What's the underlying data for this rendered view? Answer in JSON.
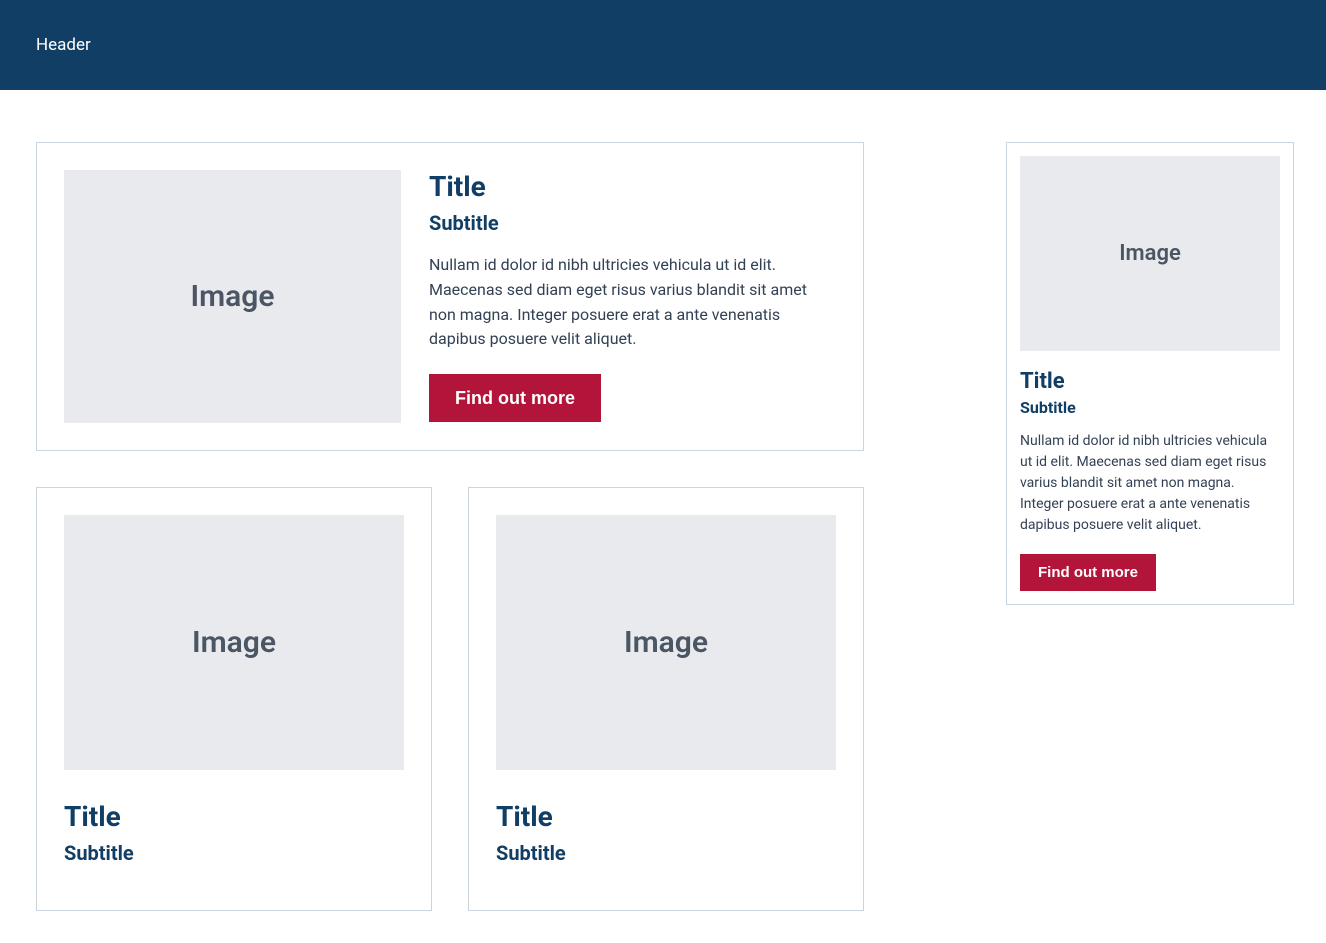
{
  "header": {
    "title": "Header"
  },
  "imagePlaceholder": "Image",
  "cards": {
    "hero": {
      "title": "Title",
      "subtitle": "Subtitle",
      "body": "Nullam id dolor id nibh ultricies vehicula ut id elit. Maecenas sed diam eget risus varius blandit sit amet non magna. Integer posuere erat a ante venenatis dapibus posuere velit aliquet.",
      "cta": "Find out more"
    },
    "grid1": {
      "title": "Title",
      "subtitle": "Subtitle"
    },
    "grid2": {
      "title": "Title",
      "subtitle": "Subtitle"
    },
    "side": {
      "title": "Title",
      "subtitle": "Subtitle",
      "body": "Nullam id dolor id nibh ultricies vehicula ut id elit. Maecenas sed diam eget risus varius blandit sit amet non magna. Integer posuere erat a ante venenatis dapibus posuere velit aliquet.",
      "cta": "Find out more"
    }
  }
}
